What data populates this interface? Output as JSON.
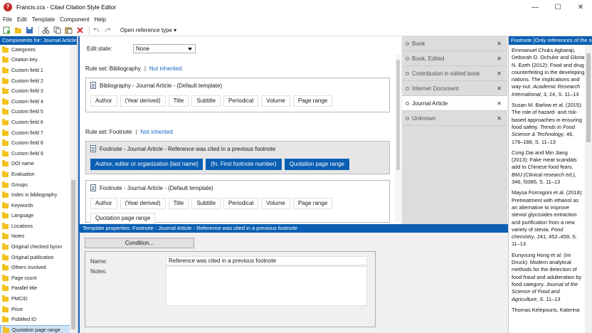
{
  "window": {
    "title": "Francis.ccs - Citavi Citation Style Editor",
    "app_icon": "?",
    "minimize": "—",
    "maximize": "☐",
    "close": "✕"
  },
  "menu": [
    "File",
    "Edit",
    "Template",
    "Component",
    "Help"
  ],
  "toolbar": {
    "open_reference_type": "Open reference type ▾"
  },
  "left_panel": {
    "header": "Components for: Journal Article",
    "items": [
      "Categories",
      "Citation key",
      "Custom field 1",
      "Custom field 2",
      "Custom field 3",
      "Custom field 4",
      "Custom field 5",
      "Custom field 6",
      "Custom field 7",
      "Custom field 8",
      "Custom field 9",
      "DOI name",
      "Evaluation",
      "Groups",
      "Index in bibliography",
      "Keywords",
      "Language",
      "Locations",
      "Notes",
      "Original checked by/on",
      "Original publication",
      "Others involved",
      "Page count",
      "Parallel title",
      "PMCID",
      "Price",
      "PubMed ID",
      "Quotation page range"
    ],
    "selected_index": 27
  },
  "editor": {
    "edit_state_label": "Edit state:",
    "edit_state_value": "None",
    "bibliography_rule": "Rule set: Bibliography",
    "bibliography_link": "Not inherited",
    "bib_template_title": "Bibliography - Journal Article - (Default template)",
    "bib_chips": [
      "Author",
      "(Year derived)",
      "Title",
      "Subtitle",
      "Periodical",
      "Volume",
      "Page range"
    ],
    "footnote_rule": "Rule set: Footnote",
    "footnote_link": "Not inherited",
    "fn1_title": "Footnote - Journal Article - Reference was cited in a previous footnote",
    "fn1_chips": [
      "Author, editor or organization [last name]",
      "(fn. First footnote number)",
      "Quotation page range"
    ],
    "fn2_title": "Footnote - Journal Article - (Default template)",
    "fn2_chips": [
      "Author",
      "(Year derived)",
      "Title",
      "Subtitle",
      "Periodical",
      "Volume",
      "Page range",
      "Quotation page range"
    ]
  },
  "ref_tabs": [
    "Book",
    "Book, Edited",
    "Contribution in edited book",
    "Internet Document",
    "Journal Article",
    "Unknown"
  ],
  "ref_tabs_active": 4,
  "right_panel": {
    "header": "Footnote [Only references of the selected type]",
    "entries": [
      {
        "text": "Emmanuel Chuks Agbaraji, Deborah O. Ochulor and Gloria N. Ezeh (2012): Food and drug counterfeiting in the developing nations. The implications and way-out.",
        "src": "Academic Research International",
        "tail": ", 3, 24, S. 11–13"
      },
      {
        "text": "Susan M. Barlow et al. (2015): The role of hazard- and risk-based approaches in ensuring food safety.",
        "src": "Trends in Food Science & Technology",
        "tail": ", 46, 176–188, S. 11–13"
      },
      {
        "text": "Cong Dai and Min Jiang (2013): Fake meat scandals add to Chinese food fears.",
        "src": "BMJ (Clinical research ed.)",
        "tail": ", 346, f3385, S. 11–13"
      },
      {
        "text": "Maysa Formigoni et al. (2018): Pretreatment with ethanol as an alternative to improve steviol glycosides extraction and purification from a new variety of stevia.",
        "src": "Food chemistry",
        "tail": ", 241, 452–459, S. 11–13"
      },
      {
        "text": "Eunyoung Hong et al. (im Druck): Modern analytical methods for the detection of food fraud and adulteration by food category.",
        "src": "Journal of the Science of Food and Agriculture",
        "tail": ", S. 11–13"
      },
      {
        "text": "Thomas Kelepouris, Katerina",
        "src": "",
        "tail": ""
      }
    ]
  },
  "properties": {
    "header": "Template properties:  Footnote - Journal Article - Reference was cited in a previous footnote",
    "condition_button": "Condition...",
    "name_label": "Name:",
    "name_value": "Reference was cited in a previous footnote",
    "notes_label": "Notes:",
    "notes_value": ""
  },
  "colors": {
    "accent": "#0b5fb3",
    "folder": "#f3c21f",
    "link": "#1565c0"
  }
}
